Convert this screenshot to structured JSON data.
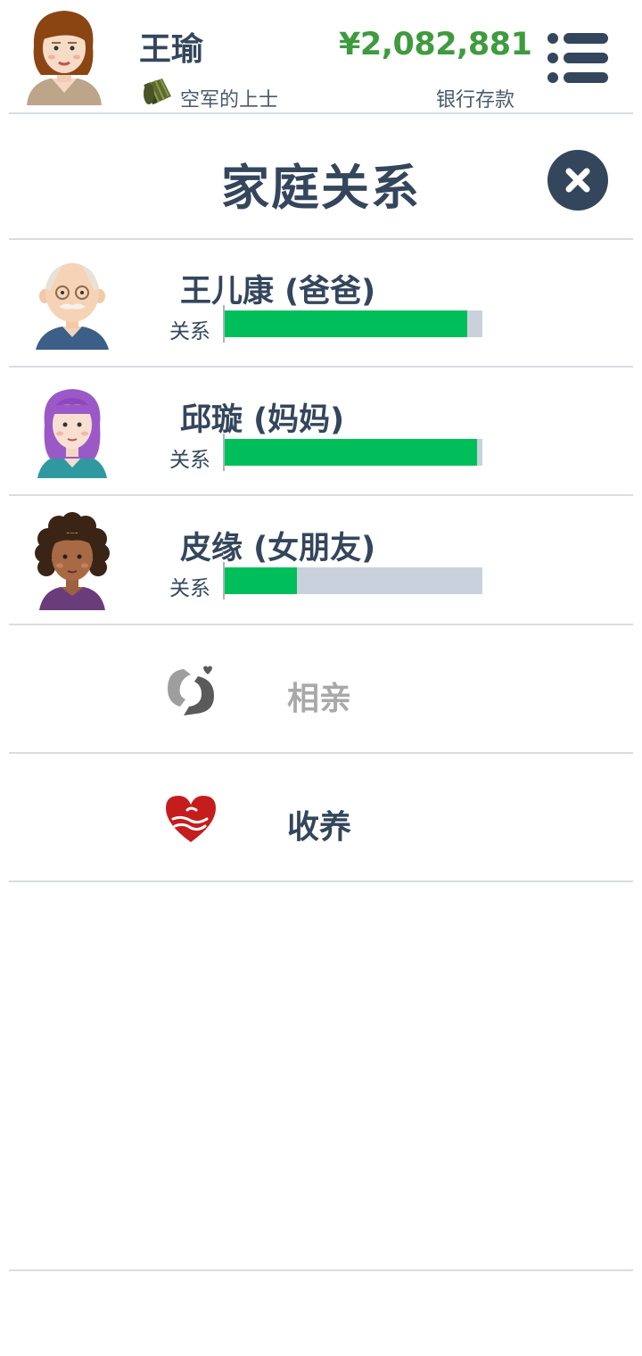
{
  "player": {
    "name": "王瑜",
    "rank": "空军的上士",
    "money": "¥2,082,881",
    "money_label": "银行存款"
  },
  "page": {
    "title": "家庭关系"
  },
  "family": [
    {
      "name": "王儿康 (爸爸)",
      "relation_label": "关系",
      "relation_level": 0.94
    },
    {
      "name": "邱璇 (妈妈)",
      "relation_label": "关系",
      "relation_level": 0.98
    },
    {
      "name": "皮缘 (女朋友)",
      "relation_label": "关系",
      "relation_level": 0.28
    }
  ],
  "actions": [
    {
      "label": "相亲",
      "icon": "matchmaking-icon",
      "enabled": false,
      "color": "#a9a9a9"
    },
    {
      "label": "收养",
      "icon": "adopt-heart-icon",
      "enabled": true,
      "color": "#34465c"
    }
  ],
  "colors": {
    "text_dark": "#34465c",
    "money_green": "#3e9b3e",
    "bar_fill": "#00bf5a",
    "bar_track": "#c9d2dc"
  }
}
